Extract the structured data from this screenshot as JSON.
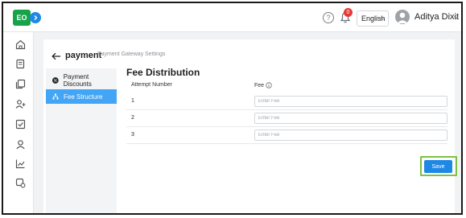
{
  "app": {
    "logo_text": "EO",
    "brand_color": "#16a34a",
    "accent_color": "#1e88e5"
  },
  "header": {
    "help_symbol": "?",
    "notification_count": "0",
    "language": "English",
    "user_name": "Aditya Dixit"
  },
  "rail": {
    "items": [
      {
        "icon": "home-icon"
      },
      {
        "icon": "ledger-icon"
      },
      {
        "icon": "documents-icon"
      },
      {
        "icon": "add-user-icon"
      },
      {
        "icon": "checkbox-icon"
      },
      {
        "icon": "user-icon"
      },
      {
        "icon": "chart-icon"
      },
      {
        "icon": "settings-gear-icon"
      }
    ]
  },
  "page": {
    "title": "payment",
    "subtitle": "Payment Gateway Settings"
  },
  "side_menu": {
    "items": [
      {
        "label": "Payment Discounts",
        "active": false,
        "icon": "discount-icon"
      },
      {
        "label": "Fee Structure",
        "active": true,
        "icon": "hierarchy-icon"
      }
    ]
  },
  "fee_distribution": {
    "title": "Fee Distribution",
    "col_attempt": "Attempt Number",
    "col_fee": "Fee",
    "rows": [
      {
        "attempt": "1",
        "fee_value": "",
        "placeholder": "Enter Fee"
      },
      {
        "attempt": "2",
        "fee_value": "",
        "placeholder": "Enter Fee"
      },
      {
        "attempt": "3",
        "fee_value": "",
        "placeholder": "Enter Fee"
      }
    ],
    "save_label": "Save"
  }
}
